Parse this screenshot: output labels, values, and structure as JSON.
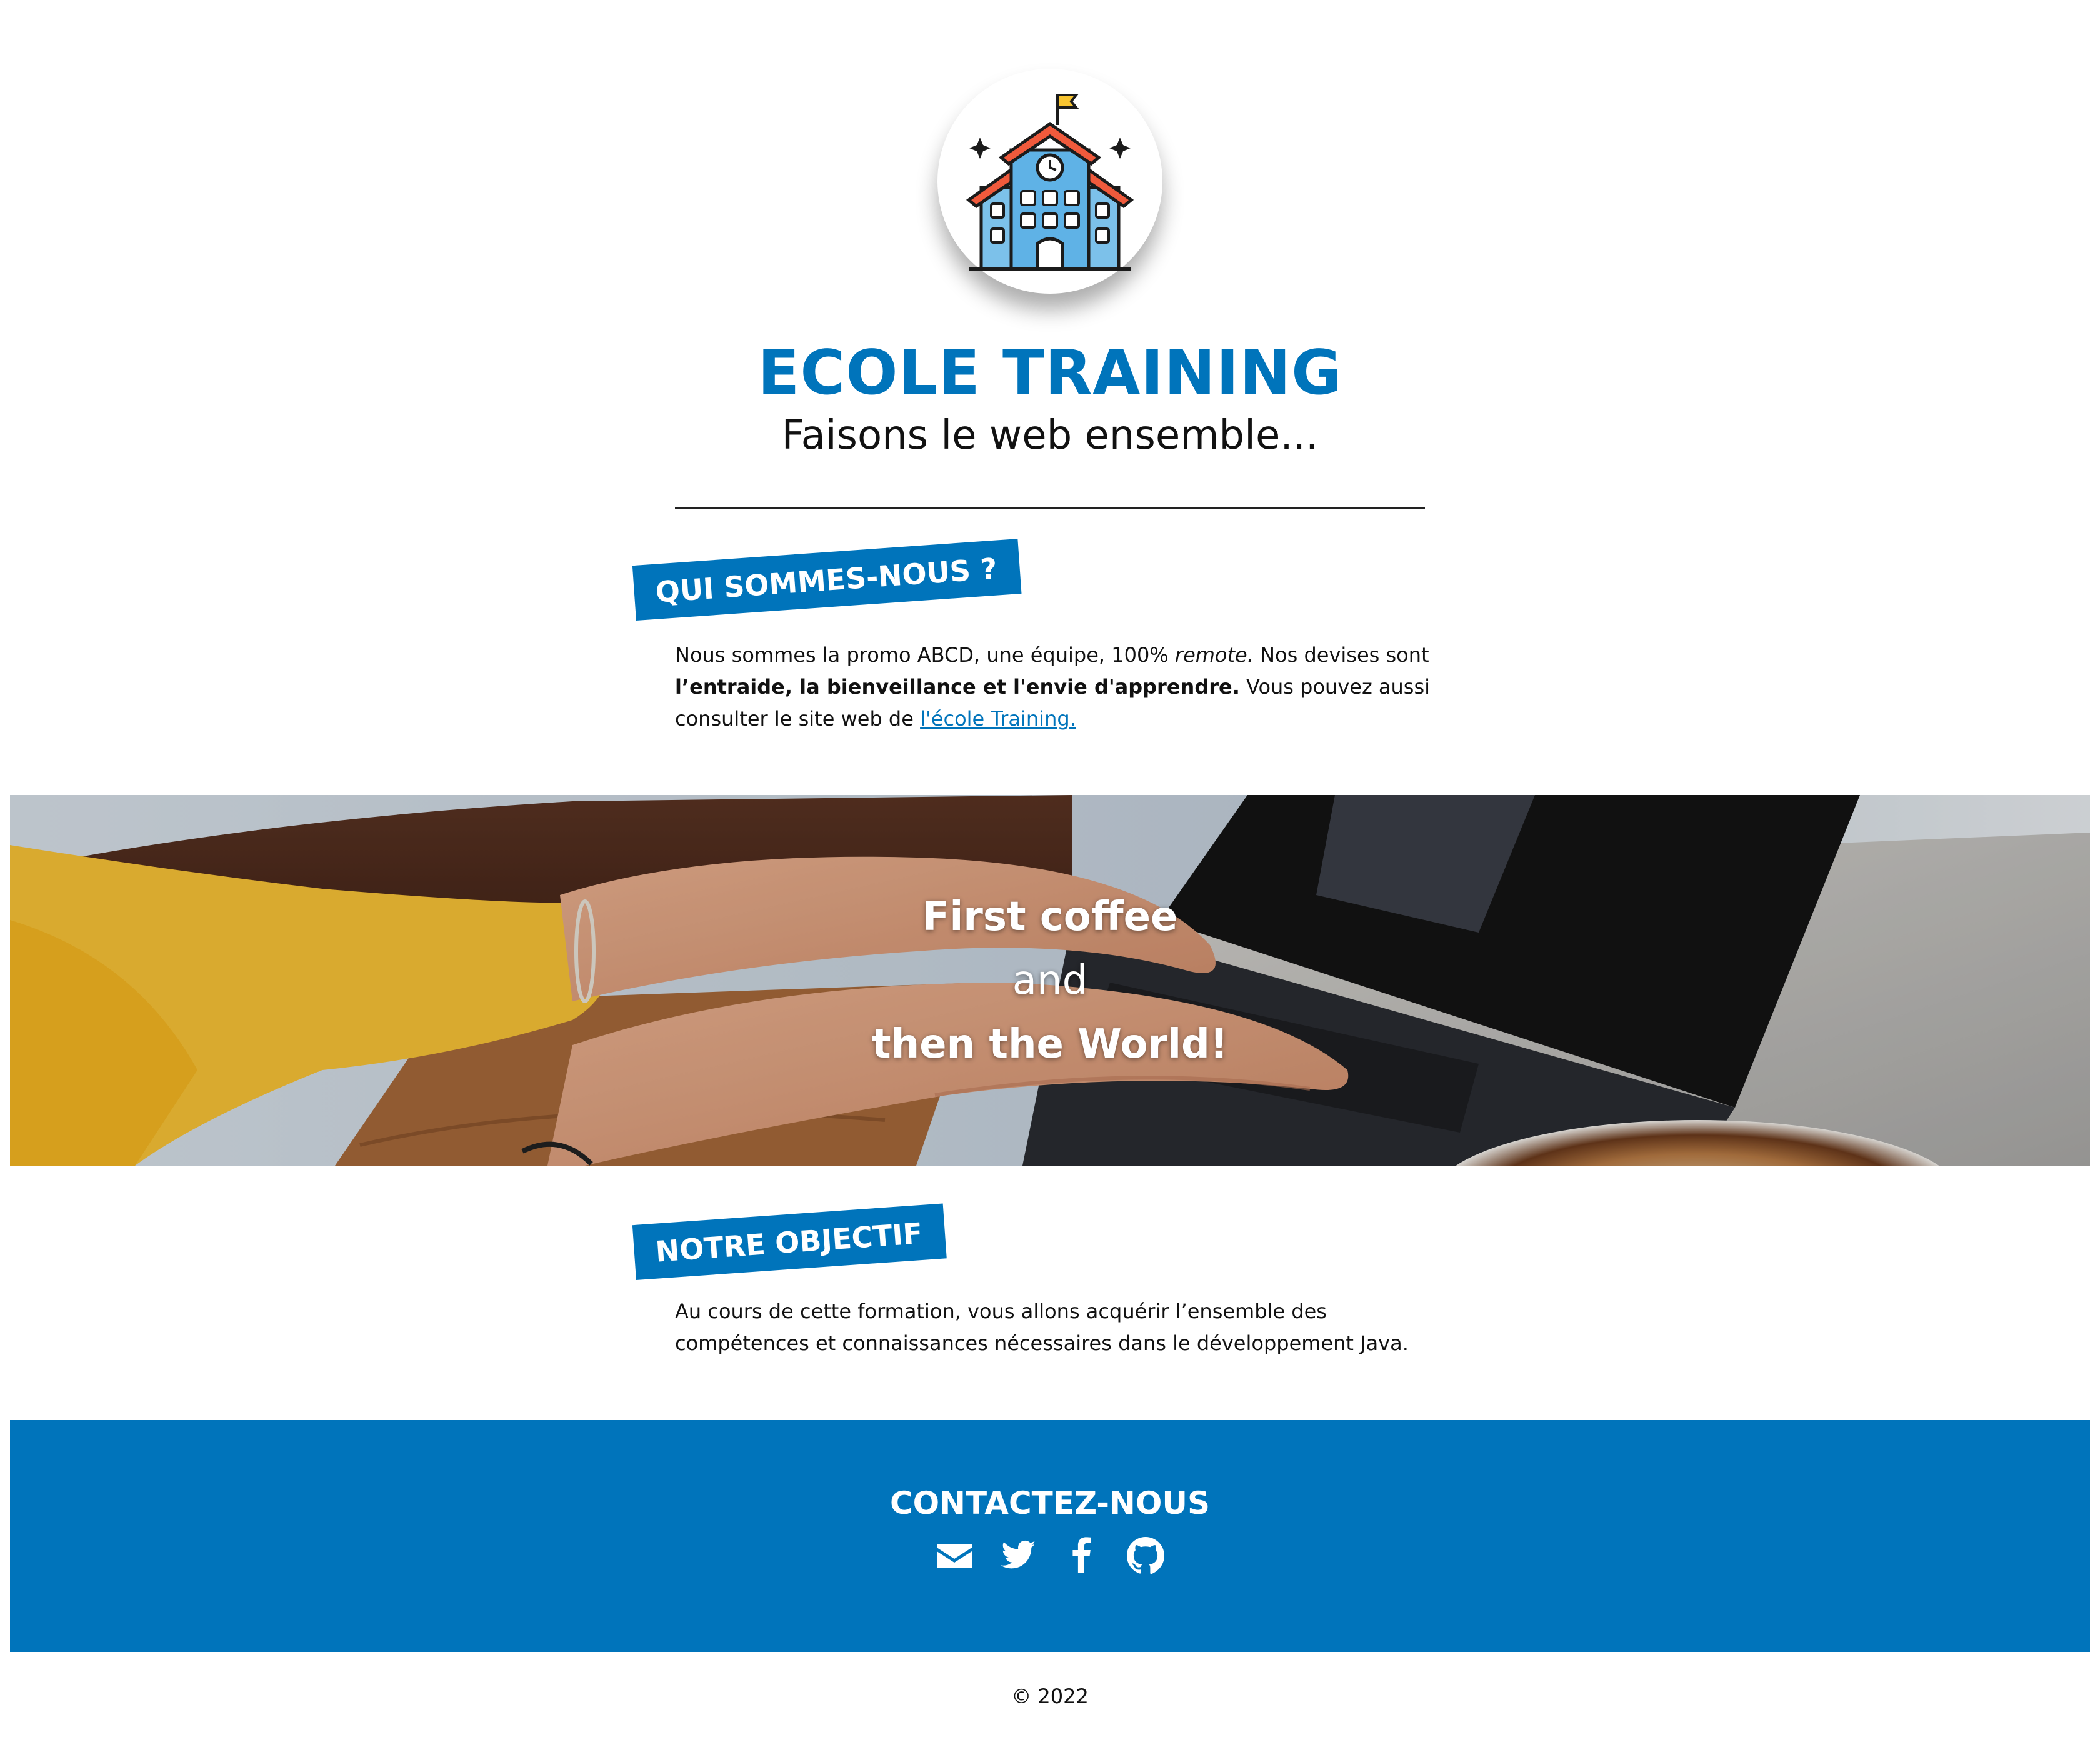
{
  "header": {
    "logo_icon": "school-building-icon",
    "title": "ECOLE TRAINING",
    "subtitle": "Faisons le web ensemble..."
  },
  "about": {
    "tag": "QUI SOMMES-NOUS ?",
    "text_1": "Nous sommes la promo ABCD, une équipe, 100% ",
    "text_italic": "remote.",
    "text_2": " Nos devises sont ",
    "text_bold": "l’entraide, la bienveillance et l'envie d'apprendre.",
    "text_3": " Vous pouvez aussi consulter le site web de ",
    "link_text": "l'école Training."
  },
  "banner": {
    "line1": "First coffee",
    "line2": "and",
    "line3": "then the World!"
  },
  "goal": {
    "tag": "NOTRE OBJECTIF",
    "text": "Au cours de cette formation, vous allons acquérir l’ensemble des compétences et connaissances nécessaires dans le développement Java."
  },
  "footer": {
    "contact_title": "CONTACTEZ-NOUS",
    "icons": [
      "envelope-icon",
      "twitter-icon",
      "facebook-icon",
      "github-icon"
    ],
    "copyright": "© 2022"
  },
  "colors": {
    "brand_blue": "#0074bb",
    "text": "#111111",
    "background": "#ffffff"
  }
}
